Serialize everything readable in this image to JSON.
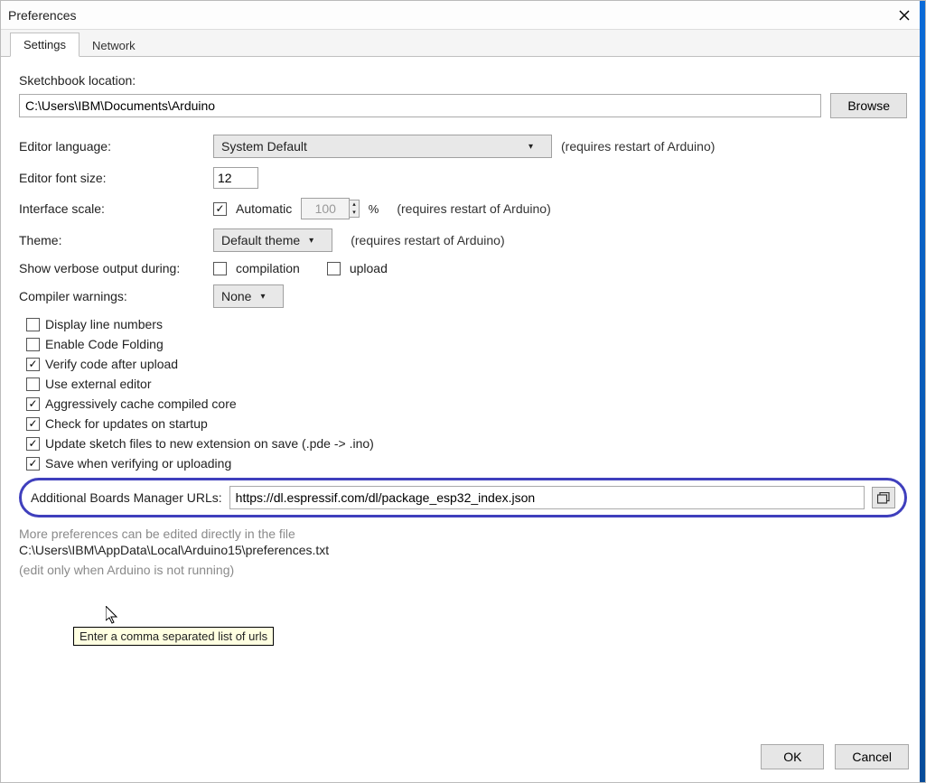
{
  "window": {
    "title": "Preferences"
  },
  "tabs": {
    "settings": "Settings",
    "network": "Network"
  },
  "sketchbook": {
    "label": "Sketchbook location:",
    "value": "C:\\Users\\IBM\\Documents\\Arduino",
    "browse": "Browse"
  },
  "lang": {
    "label": "Editor language:",
    "value": "System Default",
    "hint": "(requires restart of Arduino)"
  },
  "fontsize": {
    "label": "Editor font size:",
    "value": "12"
  },
  "scale": {
    "label": "Interface scale:",
    "auto": "Automatic",
    "value": "100",
    "pct": "%",
    "hint": "(requires restart of Arduino)"
  },
  "theme": {
    "label": "Theme:",
    "value": "Default theme",
    "hint": "(requires restart of Arduino)"
  },
  "verbose": {
    "label": "Show verbose output during:",
    "compile": "compilation",
    "upload": "upload"
  },
  "warnings": {
    "label": "Compiler warnings:",
    "value": "None"
  },
  "checks": {
    "linenum": "Display line numbers",
    "fold": "Enable Code Folding",
    "verify": "Verify code after upload",
    "external": "Use external editor",
    "cache": "Aggressively cache compiled core",
    "updates": "Check for updates on startup",
    "ext": "Update sketch files to new extension on save (.pde -> .ino)",
    "save": "Save when verifying or uploading"
  },
  "boards": {
    "label": "Additional Boards Manager URLs:",
    "value": "https://dl.espressif.com/dl/package_esp32_index.json",
    "tooltip": "Enter a comma separated list of urls"
  },
  "footer": {
    "more": "More preferences can be edited directly in the file",
    "path": "C:\\Users\\IBM\\AppData\\Local\\Arduino15\\preferences.txt",
    "edit": "(edit only when Arduino is not running)"
  },
  "buttons": {
    "ok": "OK",
    "cancel": "Cancel"
  }
}
